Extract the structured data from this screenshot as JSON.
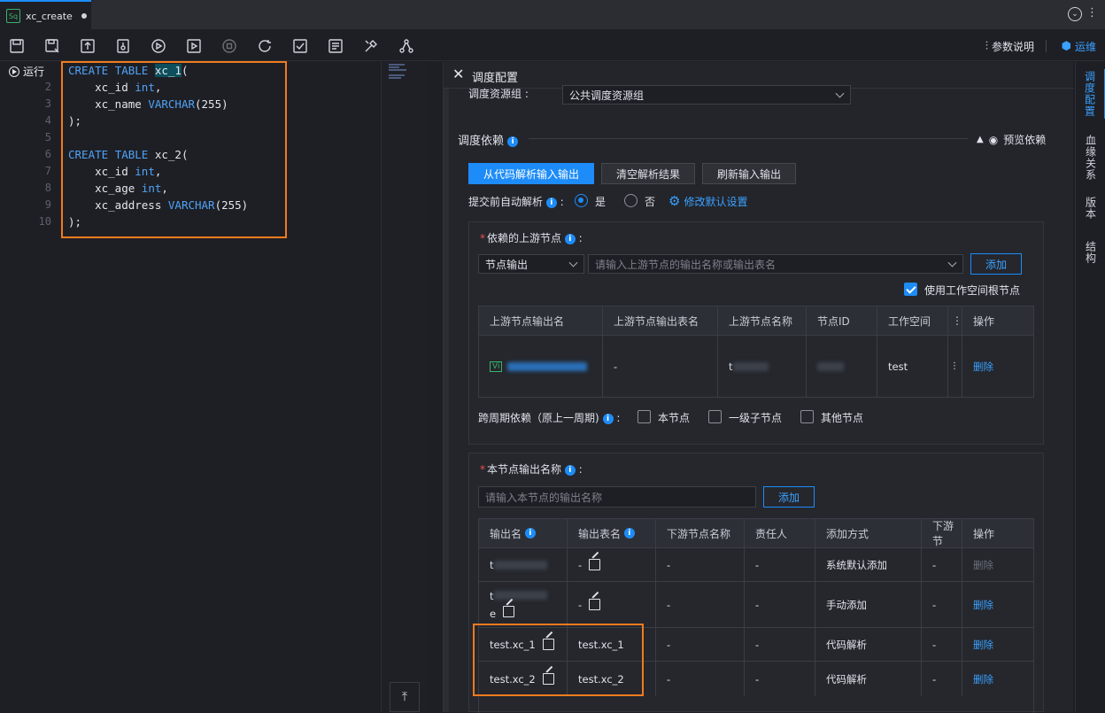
{
  "tab": {
    "badge": "Sq",
    "name": "xc_create"
  },
  "toolbar": {
    "icons": [
      "save-icon",
      "save-as-icon",
      "submit-icon",
      "lock-icon",
      "run-icon",
      "run-params-icon",
      "stop-icon",
      "reload-icon",
      "check-icon",
      "format-icon",
      "tools-icon",
      "graph-icon"
    ],
    "params_label": "参数说明",
    "ops_label": "运维"
  },
  "editor": {
    "run_label": "运行",
    "line_numbers": [
      "2",
      "3",
      "4",
      "5",
      "6",
      "7",
      "8",
      "9",
      "10"
    ]
  },
  "panel": {
    "title": "调度配置",
    "resource_group_label": "调度资源组 :",
    "resource_group_value": "公共调度资源组",
    "dependency_title": "调度依赖",
    "preview_label": "预览依赖",
    "buttons": {
      "parse": "从代码解析输入输出",
      "clear": "清空解析结果",
      "refresh": "刷新输入输出"
    },
    "auto_parse_label": "提交前自动解析",
    "yes": "是",
    "no": "否",
    "modify_default": "修改默认设置",
    "upstream": {
      "title": "依赖的上游节点",
      "type_value": "节点输出",
      "search_placeholder": "请输入上游节点的输出名称或输出表名",
      "add": "添加",
      "use_root_label": "使用工作空间根节点",
      "headers": [
        "上游节点输出名",
        "上游节点输出表名",
        "上游节点名称",
        "节点ID",
        "工作空间",
        "",
        "操作"
      ],
      "row": {
        "badge": "Vi",
        "output_table": "-",
        "name_prefix": "t",
        "workspace": "test",
        "action": "删除"
      }
    },
    "cross_cycle": {
      "label": "跨周期依赖（原上一周期)",
      "options": [
        "本节点",
        "一级子节点",
        "其他节点"
      ]
    },
    "output": {
      "title": "本节点输出名称",
      "placeholder": "请输入本节点的输出名称",
      "add": "添加",
      "headers": [
        "输出名",
        "输出表名",
        "下游节点名称",
        "责任人",
        "添加方式",
        "下游节",
        "操作"
      ],
      "rows": [
        {
          "name": "t",
          "table": "-",
          "downstream": "-",
          "owner": "-",
          "method": "系统默认添加",
          "down2": "-",
          "action": "删除",
          "disabled": true
        },
        {
          "name": "t",
          "name2": "e",
          "table": "-",
          "downstream": "-",
          "owner": "-",
          "method": "手动添加",
          "down2": "-",
          "action": "删除",
          "disabled": false
        },
        {
          "name": "test.xc_1",
          "table": "test.xc_1",
          "downstream": "-",
          "owner": "-",
          "method": "代码解析",
          "down2": "-",
          "action": "删除",
          "disabled": false
        },
        {
          "name": "test.xc_2",
          "table": "test.xc_2",
          "downstream": "-",
          "owner": "-",
          "method": "代码解析",
          "down2": "-",
          "action": "删除",
          "disabled": false
        }
      ]
    }
  },
  "rail": [
    "调度配置",
    "血缘关系",
    "版本",
    "结构"
  ],
  "colors": {
    "accent": "#1d8cf8",
    "highlight_box": "#f07b1e",
    "bg": "#1e1f25"
  }
}
